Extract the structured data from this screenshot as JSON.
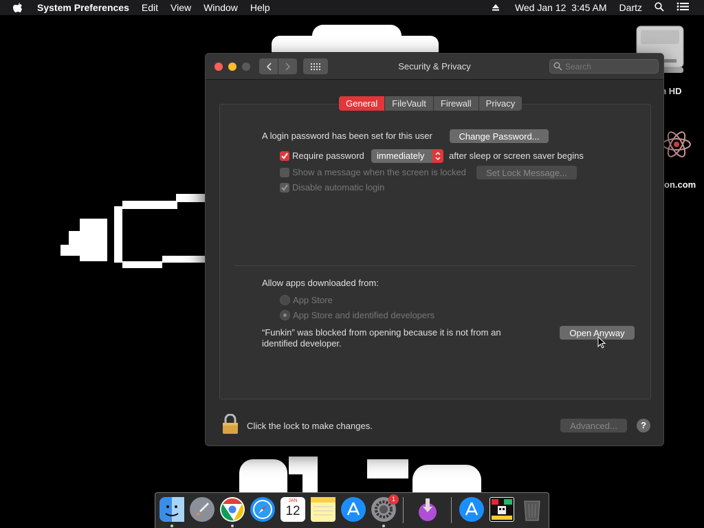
{
  "menubar": {
    "app_name": "System Preferences",
    "menus": [
      "Edit",
      "View",
      "Window",
      "Help"
    ],
    "datetime": "Wed Jan 12  3:45 AM",
    "user": "Dartz"
  },
  "desktop": {
    "drive_label": "sh HD",
    "atom_label": "on.com"
  },
  "window": {
    "title": "Security & Privacy",
    "search_placeholder": "Search",
    "tabs": [
      "General",
      "FileVault",
      "Firewall",
      "Privacy"
    ],
    "active_tab": "General",
    "general": {
      "login_password_text": "A login password has been set for this user",
      "change_password_label": "Change Password...",
      "require_password_label": "Require password",
      "require_password_checked": true,
      "require_password_delay": "immediately",
      "after_sleep_text": "after sleep or screen saver begins",
      "show_message_label": "Show a message when the screen is locked",
      "show_message_checked": false,
      "set_lock_message_label": "Set Lock Message...",
      "disable_auto_login_label": "Disable automatic login",
      "disable_auto_login_checked": true,
      "allow_apps_label": "Allow apps downloaded from:",
      "app_store_label": "App Store",
      "app_store_devs_label": "App Store and identified developers",
      "selected_source": "App Store and identified developers",
      "blocked_line1": "“Funkin” was blocked from opening because it is not from an",
      "blocked_line2": "identified developer.",
      "open_anyway_label": "Open Anyway"
    },
    "lock_text": "Click the lock to make changes.",
    "advanced_label": "Advanced...",
    "help_label": "?"
  },
  "dock": {
    "calendar_month": "JAN",
    "calendar_day": "12",
    "system_prefs_badge": "1",
    "items": [
      "Finder",
      "Launchpad",
      "Chrome",
      "Safari",
      "Calendar",
      "Notes",
      "App Store",
      "System Preferences",
      "Installer",
      "App Store Folder",
      "Funkin",
      "Trash"
    ]
  },
  "colors": {
    "accent": "#e0373a",
    "window_bg": "#2d2d2d",
    "menubar_bg": "#1c1c1e"
  }
}
